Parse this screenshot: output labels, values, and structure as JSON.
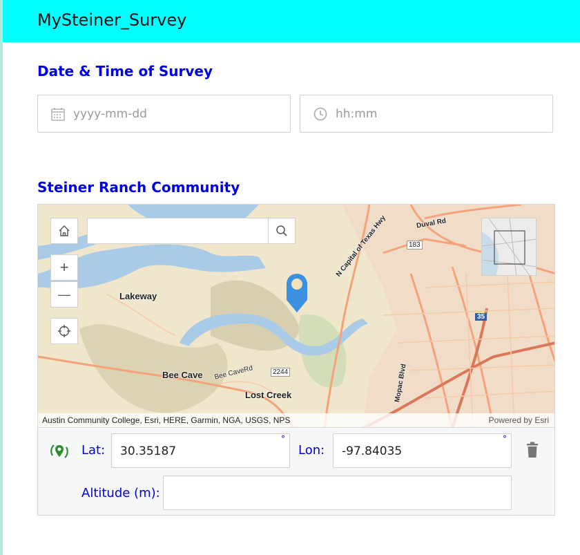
{
  "app": {
    "title": "MySteiner_Survey"
  },
  "date_time": {
    "section_title": "Date & Time of Survey",
    "date_placeholder": "yyyy-mm-dd",
    "time_placeholder": "hh:mm"
  },
  "community": {
    "section_title": "Steiner Ranch Community",
    "map": {
      "search_placeholder": "",
      "zoom_in": "+",
      "zoom_out": "—",
      "labels": {
        "lakeway": "Lakeway",
        "bee_cave": "Bee Cave",
        "lost_creek": "Lost Creek",
        "bee_cave_rd": "Bee CaveRd",
        "road_2244": "2244",
        "road_183": "183",
        "road_35": "35",
        "capital_texas_hwy": "N Capital of Texas Hwy",
        "mopac_blvd": "Mopac Blvd",
        "duval_rd": "Duval Rd"
      },
      "attribution": "Austin Community College, Esri, HERE, Garmin, NGA, USGS, NPS",
      "powered_by_prefix": "Powered by ",
      "powered_by_brand": "Esri"
    },
    "coordinates": {
      "lat_label": "Lat:",
      "lat_value": "30.35187",
      "lon_label": "Lon:",
      "lon_value": "-97.84035",
      "degree_symbol": "°",
      "altitude_label": "Altitude (m):",
      "altitude_value": ""
    }
  },
  "colors": {
    "header_bg": "#00ffff",
    "section_title": "#0000e6",
    "pin": "#3d8fe0",
    "locate_icon": "#2e8b2e"
  }
}
